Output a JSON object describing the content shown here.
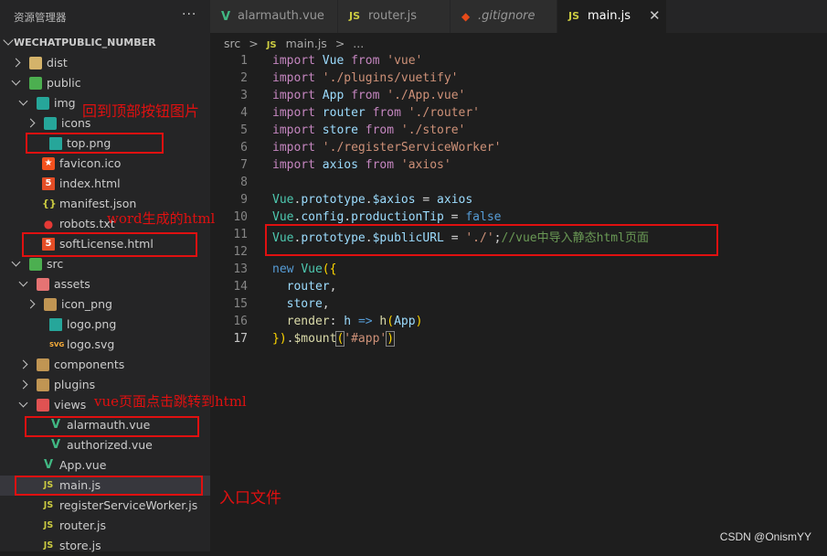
{
  "explorer": {
    "title": "资源管理器",
    "more": "···",
    "project": "WECHATPUBLIC_NUMBER",
    "items": [
      {
        "label": "dist",
        "type": "folder",
        "icon": "folder-dist-icon",
        "state": "closed",
        "depth": 0
      },
      {
        "label": "public",
        "type": "folder",
        "icon": "folder-public-icon",
        "state": "open",
        "depth": 0
      },
      {
        "label": "img",
        "type": "folder",
        "icon": "folder-images-icon",
        "state": "open",
        "depth": 1
      },
      {
        "label": "icons",
        "type": "folder",
        "icon": "folder-images-icon",
        "state": "closed",
        "depth": 2
      },
      {
        "label": "top.png",
        "type": "file",
        "icon": "image-icon",
        "depth": 2
      },
      {
        "label": "favicon.ico",
        "type": "file",
        "icon": "favicon-icon",
        "depth": 1
      },
      {
        "label": "index.html",
        "type": "file",
        "icon": "html-icon",
        "depth": 1
      },
      {
        "label": "manifest.json",
        "type": "file",
        "icon": "json-icon",
        "depth": 1
      },
      {
        "label": "robots.txt",
        "type": "file",
        "icon": "robot-icon",
        "depth": 1
      },
      {
        "label": "softLicense.html",
        "type": "file",
        "icon": "html-icon",
        "depth": 1
      },
      {
        "label": "src",
        "type": "folder",
        "icon": "folder-src-icon",
        "state": "open",
        "depth": 0
      },
      {
        "label": "assets",
        "type": "folder",
        "icon": "folder-assets-icon",
        "state": "open",
        "depth": 1
      },
      {
        "label": "icon_png",
        "type": "folder",
        "icon": "folder-icon",
        "state": "closed",
        "depth": 2
      },
      {
        "label": "logo.png",
        "type": "file",
        "icon": "image-icon",
        "depth": 2
      },
      {
        "label": "logo.svg",
        "type": "file",
        "icon": "svg-icon",
        "depth": 2
      },
      {
        "label": "components",
        "type": "folder",
        "icon": "folder-components-icon",
        "state": "closed",
        "depth": 1
      },
      {
        "label": "plugins",
        "type": "folder",
        "icon": "folder-plugins-icon",
        "state": "closed",
        "depth": 1
      },
      {
        "label": "views",
        "type": "folder",
        "icon": "folder-views-icon",
        "state": "open",
        "depth": 1
      },
      {
        "label": "alarmauth.vue",
        "type": "file",
        "icon": "vue-icon",
        "depth": 2
      },
      {
        "label": "authorized.vue",
        "type": "file",
        "icon": "vue-icon",
        "depth": 2
      },
      {
        "label": "App.vue",
        "type": "file",
        "icon": "vue-icon",
        "depth": 1
      },
      {
        "label": "main.js",
        "type": "file",
        "icon": "js-icon",
        "depth": 1,
        "selected": true
      },
      {
        "label": "registerServiceWorker.js",
        "type": "file",
        "icon": "js-icon",
        "depth": 1
      },
      {
        "label": "router.js",
        "type": "file",
        "icon": "js-icon",
        "depth": 1
      },
      {
        "label": "store.js",
        "type": "file",
        "icon": "js-icon",
        "depth": 1
      }
    ]
  },
  "tabs": [
    {
      "label": "alarmauth.vue",
      "icon": "V",
      "iconName": "vue-icon",
      "active": false
    },
    {
      "label": "router.js",
      "icon": "JS",
      "iconName": "js-icon",
      "active": false
    },
    {
      "label": ".gitignore",
      "icon": "◆",
      "iconName": "git-icon",
      "active": false
    },
    {
      "label": "main.js",
      "icon": "JS",
      "iconName": "js-icon",
      "active": true,
      "close": "✕"
    }
  ],
  "breadcrumb": {
    "folder": "src",
    "sep": ">",
    "icon": "JS",
    "file": "main.js",
    "more": "..."
  },
  "code": {
    "current_line": 17,
    "lines": [
      [
        [
          "kw2",
          "import"
        ],
        [
          "pun",
          " "
        ],
        [
          "id",
          "Vue"
        ],
        [
          "pun",
          " "
        ],
        [
          "kw2",
          "from"
        ],
        [
          "pun",
          " "
        ],
        [
          "str",
          "'vue'"
        ]
      ],
      [
        [
          "kw2",
          "import"
        ],
        [
          "pun",
          " "
        ],
        [
          "str",
          "'./plugins/vuetify'"
        ]
      ],
      [
        [
          "kw2",
          "import"
        ],
        [
          "pun",
          " "
        ],
        [
          "id",
          "App"
        ],
        [
          "pun",
          " "
        ],
        [
          "kw2",
          "from"
        ],
        [
          "pun",
          " "
        ],
        [
          "str",
          "'./App.vue'"
        ]
      ],
      [
        [
          "kw2",
          "import"
        ],
        [
          "pun",
          " "
        ],
        [
          "id",
          "router"
        ],
        [
          "pun",
          " "
        ],
        [
          "kw2",
          "from"
        ],
        [
          "pun",
          " "
        ],
        [
          "str",
          "'./router'"
        ]
      ],
      [
        [
          "kw2",
          "import"
        ],
        [
          "pun",
          " "
        ],
        [
          "id",
          "store"
        ],
        [
          "pun",
          " "
        ],
        [
          "kw2",
          "from"
        ],
        [
          "pun",
          " "
        ],
        [
          "str",
          "'./store'"
        ]
      ],
      [
        [
          "kw2",
          "import"
        ],
        [
          "pun",
          " "
        ],
        [
          "str",
          "'./registerServiceWorker'"
        ]
      ],
      [
        [
          "kw2",
          "import"
        ],
        [
          "pun",
          " "
        ],
        [
          "id",
          "axios"
        ],
        [
          "pun",
          " "
        ],
        [
          "kw2",
          "from"
        ],
        [
          "pun",
          " "
        ],
        [
          "str",
          "'axios'"
        ]
      ],
      [],
      [
        [
          "cls",
          "Vue"
        ],
        [
          "pun",
          "."
        ],
        [
          "id",
          "prototype"
        ],
        [
          "pun",
          "."
        ],
        [
          "id",
          "$axios"
        ],
        [
          "pun",
          " = "
        ],
        [
          "id",
          "axios"
        ]
      ],
      [
        [
          "cls",
          "Vue"
        ],
        [
          "pun",
          "."
        ],
        [
          "id",
          "config"
        ],
        [
          "pun",
          "."
        ],
        [
          "id",
          "productionTip"
        ],
        [
          "pun",
          " = "
        ],
        [
          "kw",
          "false"
        ]
      ],
      [
        [
          "cls",
          "Vue"
        ],
        [
          "pun",
          "."
        ],
        [
          "id",
          "prototype"
        ],
        [
          "pun",
          "."
        ],
        [
          "id",
          "$publicURL"
        ],
        [
          "pun",
          " = "
        ],
        [
          "str",
          "'./'"
        ],
        [
          "pun",
          ";"
        ],
        [
          "cm",
          "//vue中导入静态html页面"
        ]
      ],
      [],
      [
        [
          "kw",
          "new"
        ],
        [
          "pun",
          " "
        ],
        [
          "cls",
          "Vue"
        ],
        [
          "brk",
          "({"
        ]
      ],
      [
        [
          "pun",
          "  "
        ],
        [
          "id",
          "router"
        ],
        [
          "pun",
          ","
        ]
      ],
      [
        [
          "pun",
          "  "
        ],
        [
          "id",
          "store"
        ],
        [
          "pun",
          ","
        ]
      ],
      [
        [
          "pun",
          "  "
        ],
        [
          "fn",
          "render"
        ],
        [
          "pun",
          ": "
        ],
        [
          "id",
          "h"
        ],
        [
          "pun",
          " "
        ],
        [
          "kw",
          "=>"
        ],
        [
          "pun",
          " "
        ],
        [
          "fn",
          "h"
        ],
        [
          "brk",
          "("
        ],
        [
          "id",
          "App"
        ],
        [
          "brk",
          ")"
        ]
      ],
      [
        [
          "brk",
          "})"
        ],
        [
          "pun",
          "."
        ],
        [
          "fn",
          "$mount"
        ],
        [
          "brk-match",
          "("
        ],
        [
          "str",
          "'#app'"
        ],
        [
          "brk-match",
          ")"
        ]
      ]
    ]
  },
  "annotations": [
    {
      "text": "回到顶部按钮图片"
    },
    {
      "text": "word生成的html"
    },
    {
      "text": "vue页面点击跳转到html"
    },
    {
      "text": "入口文件"
    }
  ],
  "watermark": "CSDN @OnismYY"
}
